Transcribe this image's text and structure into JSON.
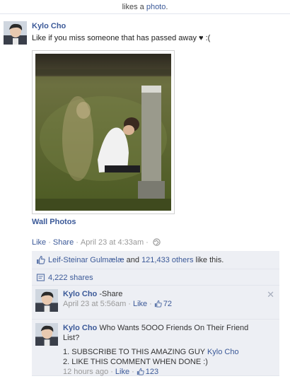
{
  "top_strip": {
    "prefix": "likes a ",
    "link": "photo",
    "suffix": "."
  },
  "post": {
    "author": "Kylo Cho",
    "message": "Like if you miss someone that has passed away ♥ :(",
    "album": "Wall Photos",
    "actions": {
      "like": "Like",
      "share": "Share",
      "timestamp": "April 23 at 4:33am"
    }
  },
  "ufi": {
    "likes": {
      "name": "Leif-Steinar Gulmælæ",
      "and": " and ",
      "others": "121,433 others",
      "suffix": " like this."
    },
    "shares": "4,222 shares"
  },
  "comments": [
    {
      "author": "Kylo Cho",
      "text": " -Share",
      "time": "April 23 at 5:56am",
      "like": "Like",
      "likes": "72"
    },
    {
      "author": "Kylo Cho",
      "text": " Who Wants 5OOO Friends On Their Friend List?",
      "line1_prefix": "1. SUBSCRIBE TO THIS AMAZING GUY ",
      "line1_link": "Kylo Cho",
      "line2": "2. LIKE THIS COMMENT WHEN DONE :)",
      "time": "12 hours ago",
      "like": "Like",
      "likes": "123"
    }
  ],
  "colors": {
    "link": "#3b5998",
    "ufi_bg": "#edeff4",
    "meta": "#999999"
  },
  "icons": [
    "profile-avatar",
    "photo-thumbnail",
    "globe-icon",
    "thumbs-up-icon",
    "share-icon",
    "close-icon"
  ]
}
